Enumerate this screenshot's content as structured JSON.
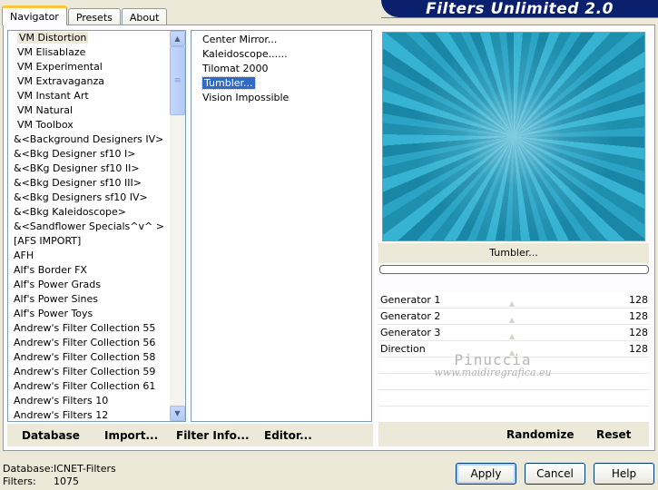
{
  "tabs": [
    {
      "label": "Navigator"
    },
    {
      "label": "Presets"
    },
    {
      "label": "About"
    }
  ],
  "banner": {
    "title": "Filters Unlimited 2.0"
  },
  "categories": [
    "VM Distortion",
    "VM Elisablaze",
    "VM Experimental",
    "VM Extravaganza",
    "VM Instant Art",
    "VM Natural",
    "VM Toolbox",
    "&<Background Designers IV>",
    "&<Bkg Designer sf10 I>",
    "&<BKg Designer sf10 II>",
    "&<Bkg Designer sf10 III>",
    "&<Bkg Designers sf10 IV>",
    "&<Bkg Kaleidoscope>",
    "&<Sandflower Specials^v^ >",
    "[AFS IMPORT]",
    "AFH",
    "Alf's Border FX",
    "Alf's Power Grads",
    "Alf's Power Sines",
    "Alf's Power Toys",
    "Andrew's Filter Collection 55",
    "Andrew's Filter Collection 56",
    "Andrew's Filter Collection 58",
    "Andrew's Filter Collection 59",
    "Andrew's Filter Collection 61",
    "Andrew's Filters 10",
    "Andrew's Filters 12"
  ],
  "filters": [
    "Center Mirror...",
    "Kaleidoscope......",
    "Tilomat 2000",
    "Tumbler...",
    "Vision Impossible"
  ],
  "preview": {
    "filter_name": "Tumbler..."
  },
  "params": [
    {
      "label": "Generator 1",
      "value": "128"
    },
    {
      "label": "Generator 2",
      "value": "128"
    },
    {
      "label": "Generator 3",
      "value": "128"
    },
    {
      "label": "Direction",
      "value": "128"
    }
  ],
  "watermark": {
    "line1": "Pinuccia",
    "line2": "www.maidiregrafica.eu"
  },
  "toolbar": {
    "database": "Database",
    "import": "Import...",
    "filter_info": "Filter Info...",
    "editor": "Editor...",
    "randomize": "Randomize",
    "reset": "Reset"
  },
  "status": {
    "database_label": "Database:",
    "database_value": "ICNET-Filters",
    "filters_label": "Filters:",
    "filters_value": "1075"
  },
  "buttons": {
    "apply": "Apply",
    "cancel": "Cancel",
    "help": "Help"
  }
}
